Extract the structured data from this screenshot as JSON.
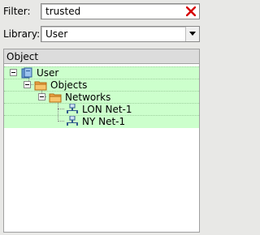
{
  "filter": {
    "label": "Filter:",
    "value": "trusted",
    "clear_icon": "x-icon"
  },
  "library": {
    "label": "Library:",
    "value": "User",
    "dropdown_icon": "chevron-down-icon"
  },
  "tree": {
    "header": "Object",
    "nodes": [
      {
        "label": "User",
        "icon": "library-icon"
      },
      {
        "label": "Objects",
        "icon": "folder-icon"
      },
      {
        "label": "Networks",
        "icon": "folder-icon"
      },
      {
        "label": "LON Net-1",
        "icon": "network-icon"
      },
      {
        "label": "NY Net-1",
        "icon": "network-icon"
      }
    ]
  }
}
